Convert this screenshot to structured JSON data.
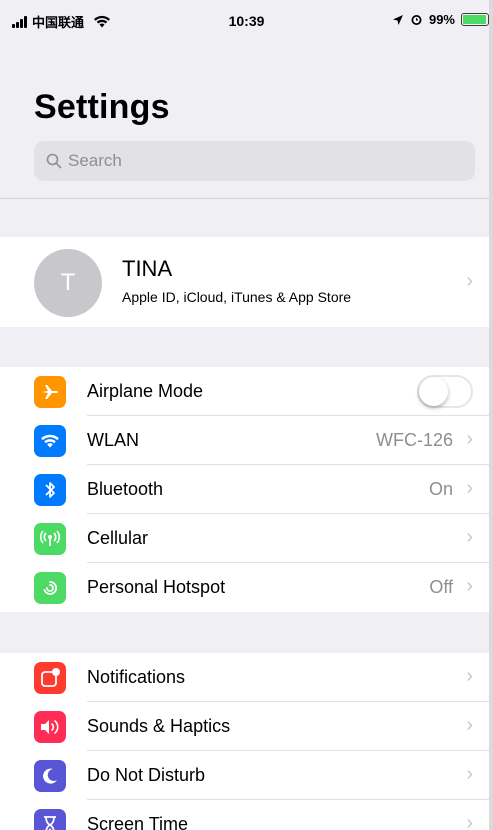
{
  "status_bar": {
    "carrier": "中国联通",
    "time": "10:39",
    "battery": "99%"
  },
  "header": {
    "title": "Settings",
    "search_placeholder": "Search"
  },
  "profile": {
    "initial": "T",
    "name": "TINA",
    "subtitle": "Apple ID, iCloud, iTunes & App Store"
  },
  "group1": [
    {
      "label": "Airplane Mode",
      "icon": "airplane-icon",
      "color": "#ff9500",
      "toggle": false
    },
    {
      "label": "WLAN",
      "value": "WFC-126",
      "icon": "wifi-icon",
      "color": "#007aff"
    },
    {
      "label": "Bluetooth",
      "value": "On",
      "icon": "bluetooth-icon",
      "color": "#007aff"
    },
    {
      "label": "Cellular",
      "value": "",
      "icon": "antenna-icon",
      "color": "#4cd964"
    },
    {
      "label": "Personal Hotspot",
      "value": "Off",
      "icon": "hotspot-icon",
      "color": "#4cd964"
    }
  ],
  "group2": [
    {
      "label": "Notifications",
      "icon": "notifications-icon",
      "color": "#ff3b30"
    },
    {
      "label": "Sounds & Haptics",
      "icon": "speaker-icon",
      "color": "#ff2d55"
    },
    {
      "label": "Do Not Disturb",
      "icon": "moon-icon",
      "color": "#5856d6"
    },
    {
      "label": "Screen Time",
      "icon": "hourglass-icon",
      "color": "#5856d6"
    }
  ],
  "colors": {
    "background": "#efeff4",
    "chevron": "#c7c7cc",
    "secondary_text": "#8e8e93"
  }
}
